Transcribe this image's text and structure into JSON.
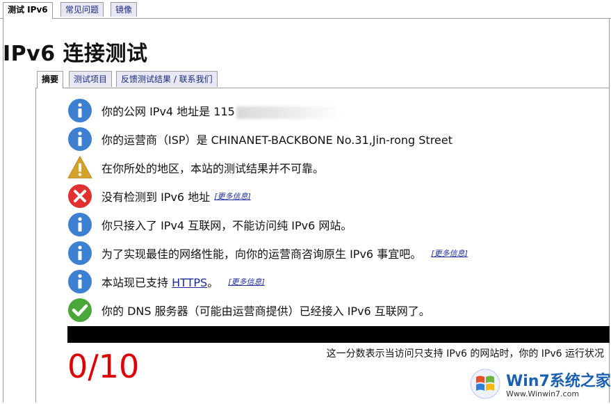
{
  "top_tabs": [
    {
      "label": "测试 IPv6",
      "active": true
    },
    {
      "label": "常见问题",
      "active": false
    },
    {
      "label": "镜像",
      "active": false
    }
  ],
  "page_title": "IPv6 连接测试",
  "inner_tabs": [
    {
      "label": "摘要",
      "active": true
    },
    {
      "label": "测试项目",
      "active": false
    },
    {
      "label": "反馈测试结果 / 联系我们",
      "active": false
    }
  ],
  "messages": {
    "ipv4": {
      "icon": "info-icon",
      "text": "你的公网 IPv4 地址是 115"
    },
    "isp": {
      "icon": "info-icon",
      "text": "你的运营商（ISP）是 CHINANET-BACKBONE No.31,Jin-rong Street"
    },
    "region": {
      "icon": "warning-icon",
      "text": "在你所处的地区，本站的测试结果并不可靠。"
    },
    "no_ipv6": {
      "icon": "error-icon",
      "text": "没有检测到 IPv6 地址",
      "more": "[更多信息]"
    },
    "ipv4_only": {
      "icon": "info-icon",
      "text": "你只接入了 IPv4 互联网，不能访问纯 IPv6 网站。"
    },
    "advice": {
      "icon": "info-icon",
      "text": "为了实现最佳的网络性能，向你的运营商咨询原生 IPv6 事宜吧。",
      "more": "[更多信息]"
    },
    "https": {
      "icon": "info-icon",
      "text_before": "本站现已支持 ",
      "link": "HTTPS",
      "text_after": "。",
      "more": "[更多信息]"
    },
    "dns": {
      "icon": "check-icon",
      "text": "你的 DNS 服务器（可能由运营商提供）已经接入 IPv6 互联网了。"
    }
  },
  "score": "0/10",
  "score_note": "这一分数表示当访问只支持 IPv6 的网站时，你的 IPv6 运行状况",
  "watermark": {
    "title": "Win7系统之家",
    "url": "Www.Winwin7.com"
  },
  "colors": {
    "info": "#3d7fd1",
    "warning": "#d4a12a",
    "error": "#e03030",
    "ok": "#4aa83a",
    "score": "#dd0000",
    "link": "#1c2a9a"
  }
}
